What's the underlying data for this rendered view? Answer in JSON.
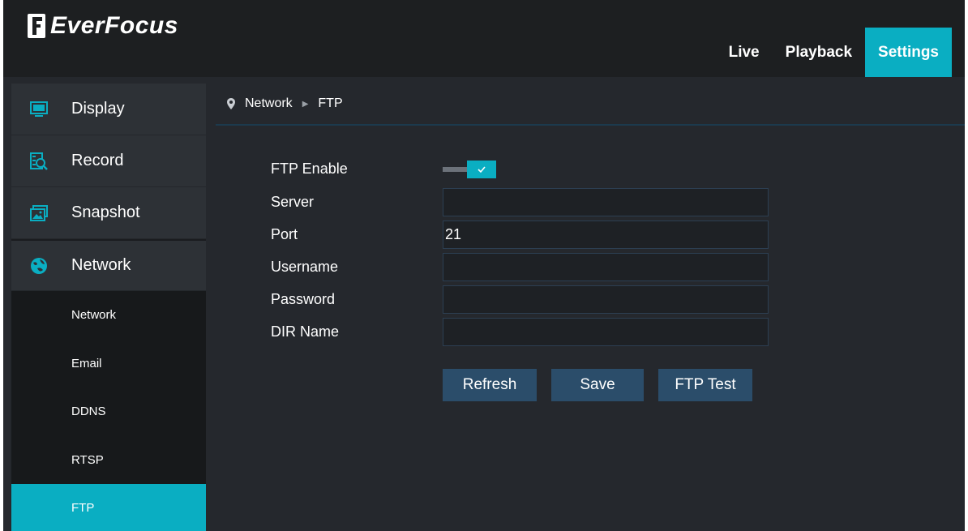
{
  "brand": {
    "name": "EverFocus"
  },
  "nav": {
    "live": "Live",
    "playback": "Playback",
    "settings": "Settings"
  },
  "sidebar": {
    "main": [
      {
        "label": "Display",
        "icon": "display-icon"
      },
      {
        "label": "Record",
        "icon": "record-icon"
      },
      {
        "label": "Snapshot",
        "icon": "snapshot-icon"
      },
      {
        "label": "Network",
        "icon": "network-globe-icon"
      }
    ],
    "sub": [
      {
        "label": "Network"
      },
      {
        "label": "Email"
      },
      {
        "label": "DDNS"
      },
      {
        "label": "RTSP"
      },
      {
        "label": "FTP",
        "active": true
      }
    ]
  },
  "breadcrumb": {
    "parent": "Network",
    "current": "FTP"
  },
  "form": {
    "ftp_enable_label": "FTP Enable",
    "ftp_enable_value": true,
    "server_label": "Server",
    "server_value": "",
    "port_label": "Port",
    "port_value": "21",
    "username_label": "Username",
    "username_value": "",
    "password_label": "Password",
    "password_value": "",
    "dir_label": "DIR Name",
    "dir_value": ""
  },
  "buttons": {
    "refresh": "Refresh",
    "save": "Save",
    "ftp_test": "FTP Test"
  },
  "colors": {
    "accent": "#0aaec2",
    "button": "#2b4d6a",
    "background": "#25282d"
  }
}
